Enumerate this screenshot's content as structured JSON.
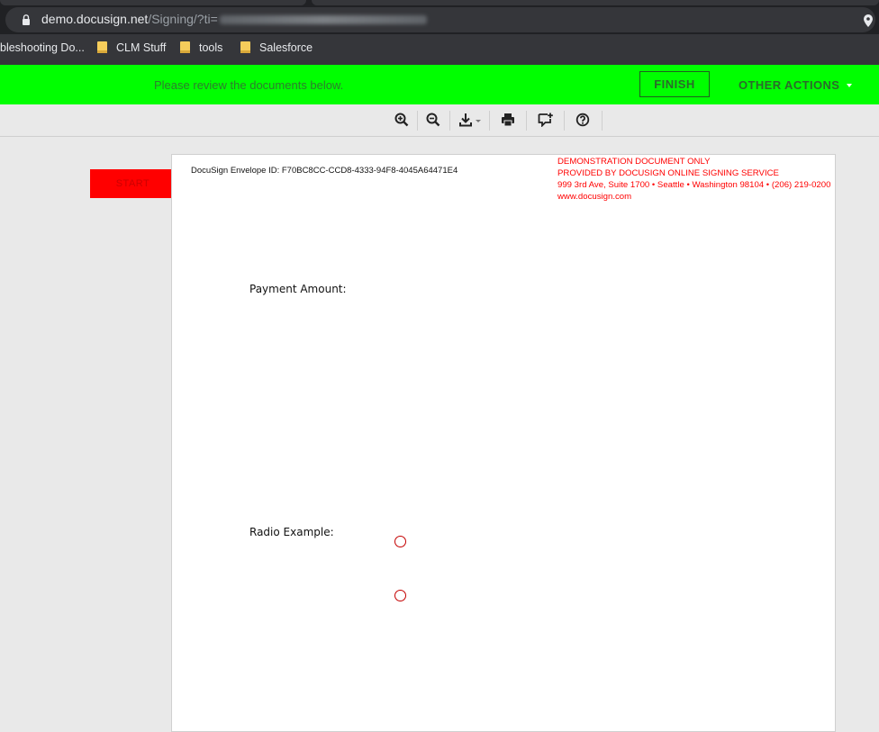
{
  "browser": {
    "url_domain": "demo.docusign.net",
    "url_path": "/Signing/?ti=",
    "icons": {
      "lock": "lock-icon",
      "location": "location-pin-icon",
      "bookmark": "folder-icon"
    }
  },
  "bookmarks": [
    {
      "label": "bleshooting Do..."
    },
    {
      "label": "CLM Stuff"
    },
    {
      "label": "tools"
    },
    {
      "label": "Salesforce"
    }
  ],
  "header": {
    "message": "Please review the documents below.",
    "finish_label": "FINISH",
    "other_actions_label": "OTHER ACTIONS",
    "accent_color": "#00ff00"
  },
  "toolbar": {
    "tools": [
      "zoom-in-icon",
      "zoom-out-icon",
      "download-icon",
      "print-icon",
      "comment-icon",
      "help-icon"
    ]
  },
  "signing": {
    "start_label": "START"
  },
  "document": {
    "envelope_id": "DocuSign Envelope ID: F70BC8CC-CCD8-4333-94F8-4045A64471E4",
    "demo_lines": [
      "DEMONSTRATION DOCUMENT ONLY",
      "PROVIDED BY DOCUSIGN ONLINE SIGNING SERVICE",
      "999 3rd Ave, Suite 1700  • Seattle • Washington 98104 • (206) 219-0200",
      "www.docusign.com"
    ],
    "payment_label": "Payment Amount:",
    "radio_label": "Radio Example:"
  }
}
